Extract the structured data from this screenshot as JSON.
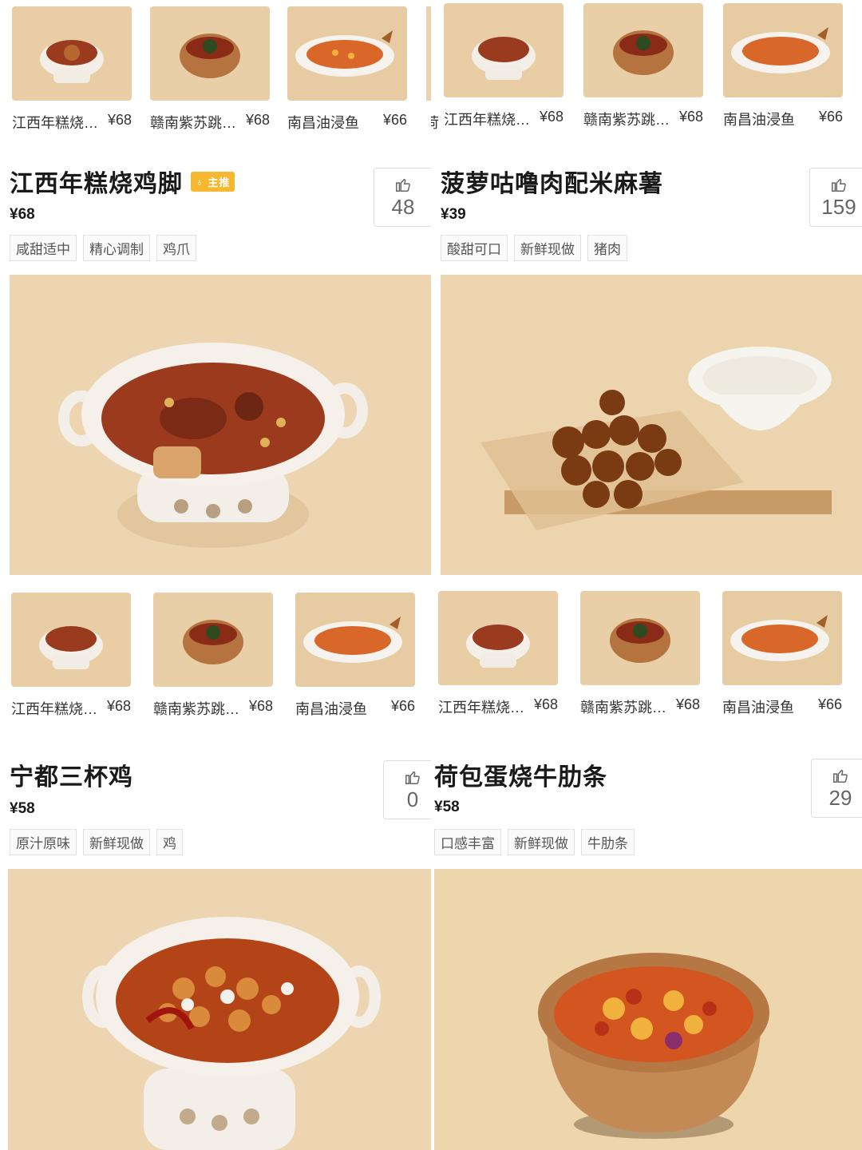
{
  "thumb_strip": [
    {
      "name": "江西年糕烧…",
      "price": "¥68",
      "dish": "clay-pot-white"
    },
    {
      "name": "赣南紫苏跳…",
      "price": "¥68",
      "dish": "clay-pot-brown"
    },
    {
      "name": "南昌油浸鱼",
      "price": "¥66",
      "dish": "fish-plate"
    }
  ],
  "panels": [
    {
      "title": "江西年糕烧鸡脚",
      "badge": "主推",
      "price": "¥68",
      "likes": "48",
      "tags": [
        "咸甜适中",
        "精心调制",
        "鸡爪"
      ],
      "hero": "white-pot"
    },
    {
      "title": "菠萝咕噜肉配米麻薯",
      "badge": "",
      "price": "¥39",
      "likes": "159",
      "tags": [
        "酸甜可口",
        "新鲜现做",
        "猪肉"
      ],
      "hero": "board"
    },
    {
      "title": "宁都三杯鸡",
      "badge": "",
      "price": "¥58",
      "likes": "0",
      "tags": [
        "原汁原味",
        "新鲜现做",
        "鸡"
      ],
      "hero": "white-pot-chicken"
    },
    {
      "title": "荷包蛋烧牛肋条",
      "badge": "",
      "price": "¥58",
      "likes": "29",
      "tags": [
        "口感丰富",
        "新鲜现做",
        "牛肋条"
      ],
      "hero": "brown-pot"
    }
  ],
  "edge_label": "荷",
  "colors": {
    "bg_food": "#ecd5b0",
    "badge": "#f5b82e",
    "like_border": "#dcdcdc"
  },
  "icons": {
    "like": "thumbs-up-icon",
    "badge": "medal-icon"
  }
}
